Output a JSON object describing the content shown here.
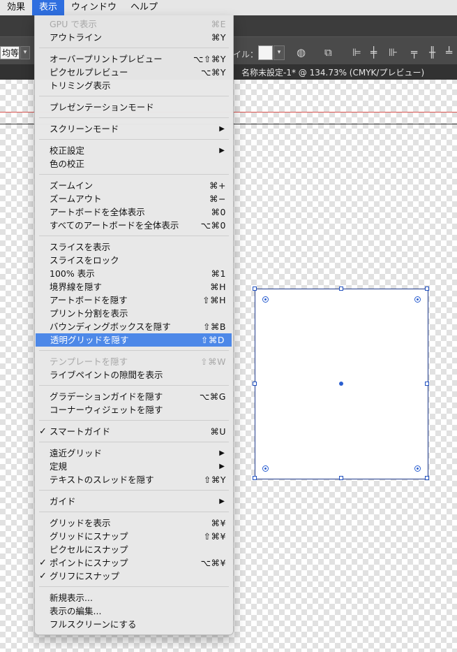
{
  "menubar": {
    "items": [
      "効果",
      "表示",
      "ウィンドウ",
      "ヘルプ"
    ]
  },
  "toolbar": {
    "field_value": "均等",
    "label": "イル：",
    "colors": {
      "accent": "#2f6fe0",
      "highlight": "#4d88e8"
    }
  },
  "document": {
    "title": "名称未設定-1* @ 134.73% (CMYK/プレビュー)"
  },
  "menu": {
    "items": [
      {
        "label": "GPU で表示",
        "shortcut": "⌘E",
        "disabled": true
      },
      {
        "label": "アウトライン",
        "shortcut": "⌘Y"
      },
      {
        "label": "オーバープリントプレビュー",
        "shortcut": "⌥⇧⌘Y"
      },
      {
        "label": "ピクセルプレビュー",
        "shortcut": "⌥⌘Y"
      },
      {
        "label": "トリミング表示",
        "shortcut": ""
      },
      {
        "label": "プレゼンテーションモード",
        "shortcut": ""
      },
      {
        "label": "スクリーンモード",
        "submenu": true
      },
      {
        "label": "校正設定",
        "submenu": true
      },
      {
        "label": "色の校正",
        "shortcut": ""
      },
      {
        "label": "ズームイン",
        "shortcut": "⌘+"
      },
      {
        "label": "ズームアウト",
        "shortcut": "⌘−"
      },
      {
        "label": "アートボードを全体表示",
        "shortcut": "⌘0"
      },
      {
        "label": "すべてのアートボードを全体表示",
        "shortcut": "⌥⌘0"
      },
      {
        "label": "スライスを表示",
        "shortcut": ""
      },
      {
        "label": "スライスをロック",
        "shortcut": ""
      },
      {
        "label": "100% 表示",
        "shortcut": "⌘1"
      },
      {
        "label": "境界線を隠す",
        "shortcut": "⌘H"
      },
      {
        "label": "アートボードを隠す",
        "shortcut": "⇧⌘H"
      },
      {
        "label": "プリント分割を表示",
        "shortcut": ""
      },
      {
        "label": "バウンディングボックスを隠す",
        "shortcut": "⇧⌘B"
      },
      {
        "label": "透明グリッドを隠す",
        "shortcut": "⇧⌘D",
        "highlighted": true
      },
      {
        "label": "テンプレートを隠す",
        "shortcut": "⇧⌘W",
        "disabled": true
      },
      {
        "label": "ライブペイントの隙間を表示",
        "shortcut": ""
      },
      {
        "label": "グラデーションガイドを隠す",
        "shortcut": "⌥⌘G"
      },
      {
        "label": "コーナーウィジェットを隠す",
        "shortcut": ""
      },
      {
        "label": "スマートガイド",
        "shortcut": "⌘U",
        "checked": true
      },
      {
        "label": "遠近グリッド",
        "submenu": true
      },
      {
        "label": "定規",
        "submenu": true
      },
      {
        "label": "テキストのスレッドを隠す",
        "shortcut": "⇧⌘Y"
      },
      {
        "label": "ガイド",
        "submenu": true
      },
      {
        "label": "グリッドを表示",
        "shortcut": "⌘¥"
      },
      {
        "label": "グリッドにスナップ",
        "shortcut": "⇧⌘¥"
      },
      {
        "label": "ピクセルにスナップ",
        "shortcut": ""
      },
      {
        "label": "ポイントにスナップ",
        "shortcut": "⌥⌘¥",
        "checked": true
      },
      {
        "label": "グリフにスナップ",
        "shortcut": "",
        "checked": true
      },
      {
        "label": "新規表示...",
        "shortcut": ""
      },
      {
        "label": "表示の編集...",
        "shortcut": ""
      },
      {
        "label": "フルスクリーンにする",
        "shortcut": ""
      }
    ]
  }
}
